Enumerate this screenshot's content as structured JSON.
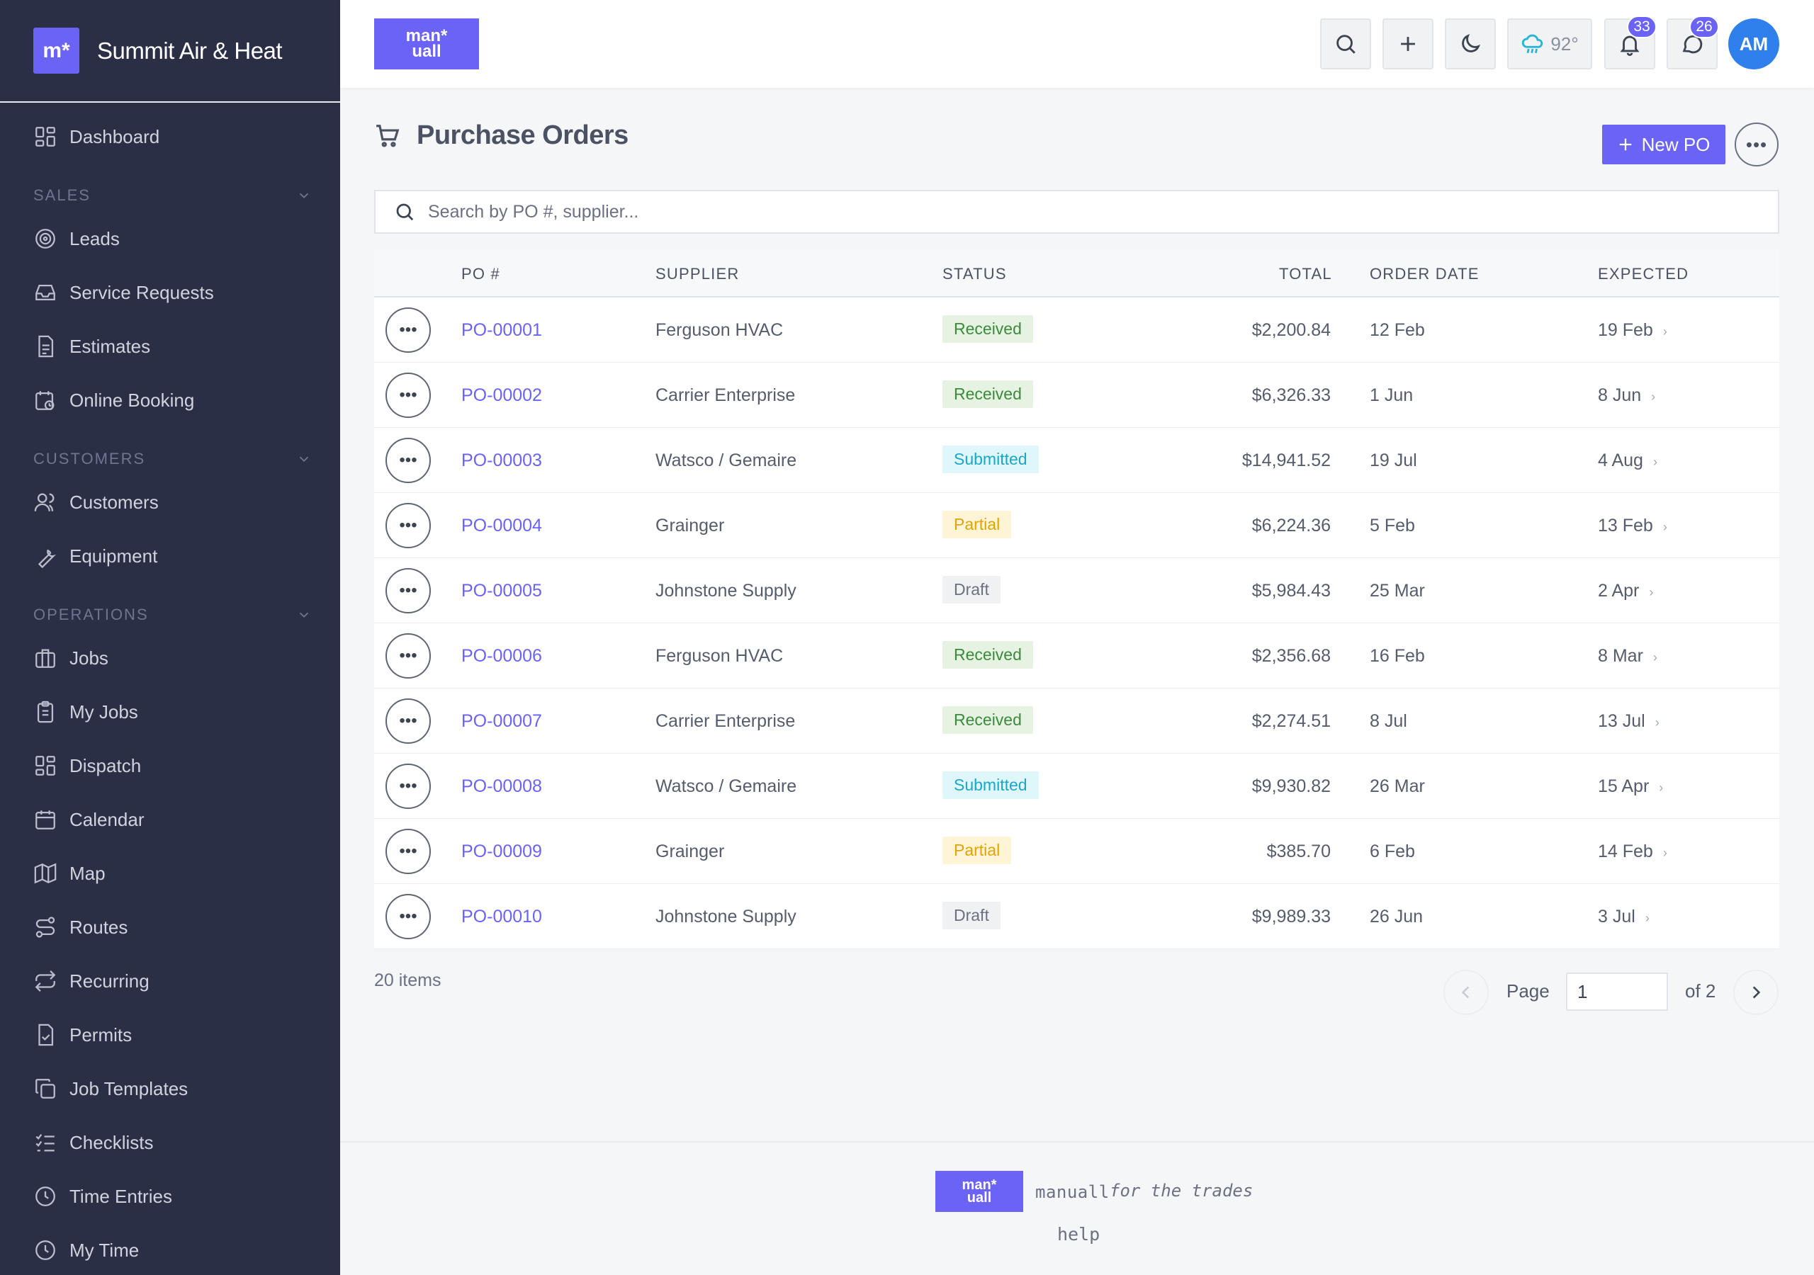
{
  "app": {
    "brand_logo": "m*",
    "company_name": "Summit Air & Heat",
    "header_logo_line1": "man*",
    "header_logo_line2": "uall"
  },
  "sidebar": {
    "items": [
      {
        "label": "Dashboard",
        "icon": "dashboard-icon"
      },
      {
        "section": "SALES"
      },
      {
        "label": "Leads",
        "icon": "target-icon"
      },
      {
        "label": "Service Requests",
        "icon": "inbox-icon"
      },
      {
        "label": "Estimates",
        "icon": "document-icon"
      },
      {
        "label": "Online Booking",
        "icon": "calendar-clock-icon"
      },
      {
        "section": "CUSTOMERS"
      },
      {
        "label": "Customers",
        "icon": "users-icon"
      },
      {
        "label": "Equipment",
        "icon": "wrench-icon"
      },
      {
        "section": "OPERATIONS"
      },
      {
        "label": "Jobs",
        "icon": "briefcase-icon"
      },
      {
        "label": "My Jobs",
        "icon": "clipboard-icon"
      },
      {
        "label": "Dispatch",
        "icon": "dashboard-icon"
      },
      {
        "label": "Calendar",
        "icon": "calendar-icon"
      },
      {
        "label": "Map",
        "icon": "map-icon"
      },
      {
        "label": "Routes",
        "icon": "route-icon"
      },
      {
        "label": "Recurring",
        "icon": "repeat-icon"
      },
      {
        "label": "Permits",
        "icon": "file-check-icon"
      },
      {
        "label": "Job Templates",
        "icon": "copy-icon"
      },
      {
        "label": "Checklists",
        "icon": "checklist-icon"
      },
      {
        "label": "Time Entries",
        "icon": "clock-icon"
      },
      {
        "label": "My Time",
        "icon": "clock-icon"
      }
    ]
  },
  "header": {
    "weather_temp": "92°",
    "notifications_count": "33",
    "messages_count": "26",
    "avatar_initials": "AM"
  },
  "page": {
    "title": "Purchase Orders",
    "new_button": "New PO",
    "more_label": "•••",
    "search_placeholder": "Search by PO #, supplier..."
  },
  "table": {
    "columns": [
      "PO #",
      "SUPPLIER",
      "STATUS",
      "TOTAL",
      "ORDER DATE",
      "EXPECTED"
    ],
    "rows": [
      {
        "po": "PO-00001",
        "supplier": "Ferguson HVAC",
        "status": "Received",
        "total": "$2,200.84",
        "order_date": "12 Feb",
        "expected": "19 Feb"
      },
      {
        "po": "PO-00002",
        "supplier": "Carrier Enterprise",
        "status": "Received",
        "total": "$6,326.33",
        "order_date": "1 Jun",
        "expected": "8 Jun"
      },
      {
        "po": "PO-00003",
        "supplier": "Watsco / Gemaire",
        "status": "Submitted",
        "total": "$14,941.52",
        "order_date": "19 Jul",
        "expected": "4 Aug"
      },
      {
        "po": "PO-00004",
        "supplier": "Grainger",
        "status": "Partial",
        "total": "$6,224.36",
        "order_date": "5 Feb",
        "expected": "13 Feb"
      },
      {
        "po": "PO-00005",
        "supplier": "Johnstone Supply",
        "status": "Draft",
        "total": "$5,984.43",
        "order_date": "25 Mar",
        "expected": "2 Apr"
      },
      {
        "po": "PO-00006",
        "supplier": "Ferguson HVAC",
        "status": "Received",
        "total": "$2,356.68",
        "order_date": "16 Feb",
        "expected": "8 Mar"
      },
      {
        "po": "PO-00007",
        "supplier": "Carrier Enterprise",
        "status": "Received",
        "total": "$2,274.51",
        "order_date": "8 Jul",
        "expected": "13 Jul"
      },
      {
        "po": "PO-00008",
        "supplier": "Watsco / Gemaire",
        "status": "Submitted",
        "total": "$9,930.82",
        "order_date": "26 Mar",
        "expected": "15 Apr"
      },
      {
        "po": "PO-00009",
        "supplier": "Grainger",
        "status": "Partial",
        "total": "$385.70",
        "order_date": "6 Feb",
        "expected": "14 Feb"
      },
      {
        "po": "PO-00010",
        "supplier": "Johnstone Supply",
        "status": "Draft",
        "total": "$9,989.33",
        "order_date": "26 Jun",
        "expected": "3 Jul"
      }
    ],
    "row_action_label": "•••",
    "row_chevron": "›"
  },
  "pagination": {
    "items_count": "20 items",
    "page_label": "Page",
    "page_value": "1",
    "of_label": "of 2"
  },
  "footer": {
    "logo_line1": "man*",
    "logo_line2": "uall",
    "brand": "manuall",
    "tagline": "for the trades",
    "help": "help"
  },
  "colors": {
    "accent": "#6a63f6",
    "sidebar_bg": "#2b2f45",
    "received": "#3c8a3c",
    "submitted": "#1aa7c6",
    "partial": "#e0a400",
    "draft": "#6b7182",
    "avatar": "#2f80ed"
  }
}
